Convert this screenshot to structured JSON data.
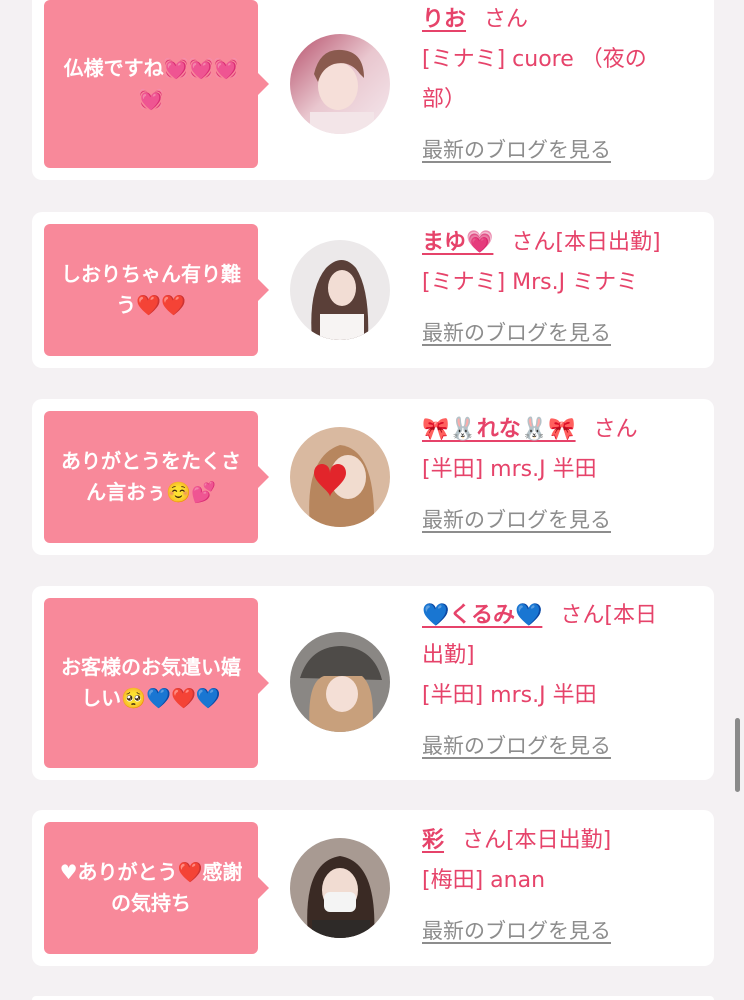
{
  "blog_link_label": "最新のブログを見る",
  "accent_color": "#e6436a",
  "bubble_color": "#f8899a",
  "entries": [
    {
      "message": "仏様ですね💓💓💓💓",
      "name": "りお",
      "honorific": "さん",
      "shop_line1": "[ミナミ] cuore （夜の",
      "shop_line2": "部）",
      "avatar_icon": "girl-photo-avatar"
    },
    {
      "message": "しおりちゃん有り難う❤️❤️",
      "name": "まゆ💗",
      "honorific": "さん[本日出勤]",
      "shop_line1": "[ミナミ] Mrs.J ミナミ",
      "avatar_icon": "girl-photo-avatar"
    },
    {
      "message": "ありがとうをたくさん言おぅ☺️💕",
      "name": "🎀🐰れな🐰🎀",
      "honorific": "さん",
      "shop_line1": "[半田] mrs.J 半田",
      "avatar_icon": "girl-photo-heart-avatar"
    },
    {
      "message": "お客様のお気遣い嬉しい🥺💙❤️💙",
      "name": "💙くるみ💙",
      "honorific": "さん[本日",
      "honorific_cont": "出勤]",
      "shop_line1": "[半田] mrs.J 半田",
      "avatar_icon": "girl-photo-cap-avatar"
    },
    {
      "message": "♥ありがとう❤️感謝の気持ち",
      "name": "彩",
      "honorific": "さん[本日出勤]",
      "shop_line1": "[梅田] anan",
      "avatar_icon": "girl-photo-mask-avatar"
    }
  ]
}
